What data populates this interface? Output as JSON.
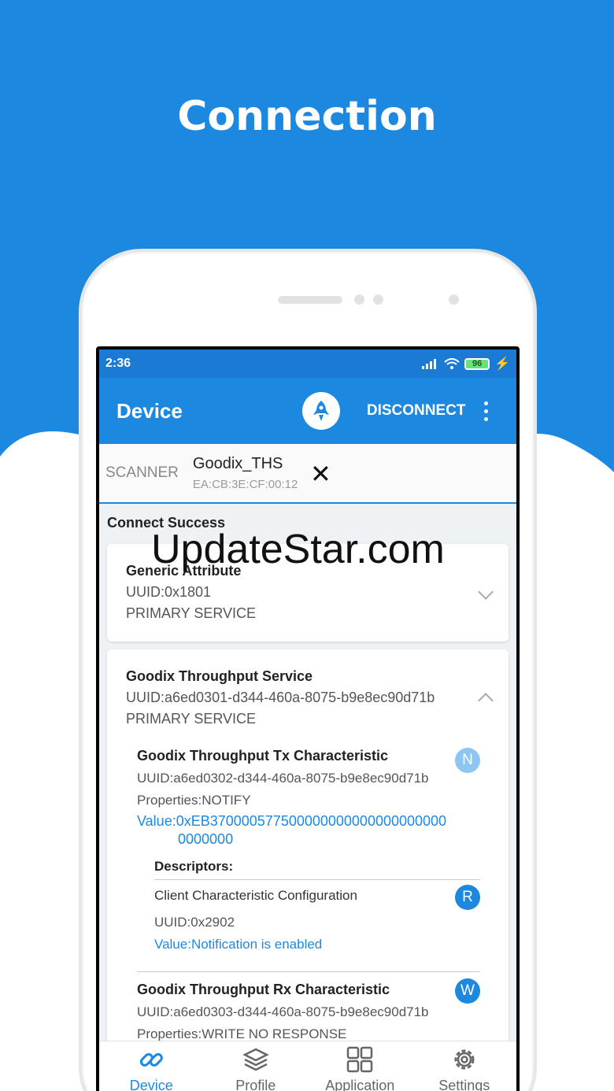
{
  "headline": "Connection",
  "status_bar": {
    "time": "2:36",
    "battery": "96"
  },
  "app_bar": {
    "title": "Device",
    "action": "DISCONNECT"
  },
  "tab_bar": {
    "scanner_label": "SCANNER",
    "device_name": "Goodix_THS",
    "device_address": "EA:CB:3E:CF:00:12",
    "close_glyph": "✕"
  },
  "content": {
    "status": "Connect Success",
    "services": [
      {
        "name": "Generic Attribute",
        "uuid": "UUID:0x1801",
        "type": "PRIMARY SERVICE"
      },
      {
        "name": "Goodix Throughput Service",
        "uuid": "UUID:a6ed0301-d344-460a-8075-b9e8ec90d71b",
        "type": "PRIMARY SERVICE"
      }
    ],
    "characteristics": [
      {
        "name": "Goodix Throughput Tx Characteristic",
        "uuid": "UUID:a6ed0302-d344-460a-8075-b9e8ec90d71b",
        "properties": "Properties:NOTIFY",
        "value": "Value:0xEB370000577500000000000000000000",
        "value_cont": "0000000",
        "badge": "N"
      },
      {
        "name": "Goodix Throughput Rx Characteristic",
        "uuid": "UUID:a6ed0303-d344-460a-8075-b9e8ec90d71b",
        "properties": "Properties:WRITE NO RESPONSE",
        "badge": "W"
      }
    ],
    "descriptors_label": "Descriptors:",
    "descriptor": {
      "name": "Client Characteristic Configuration",
      "uuid": "UUID:0x2902",
      "value": "Value:Notification is enabled",
      "badge": "R"
    }
  },
  "bottom_nav": [
    {
      "label": "Device",
      "icon": "link-icon",
      "active": true
    },
    {
      "label": "Profile",
      "icon": "layers-icon",
      "active": false
    },
    {
      "label": "Application",
      "icon": "grid-icon",
      "active": false
    },
    {
      "label": "Settings",
      "icon": "gear-icon",
      "active": false
    }
  ],
  "watermark": "UpdateStar.com",
  "colors": {
    "primary": "#1d88e0",
    "background": "#eef2f5"
  }
}
